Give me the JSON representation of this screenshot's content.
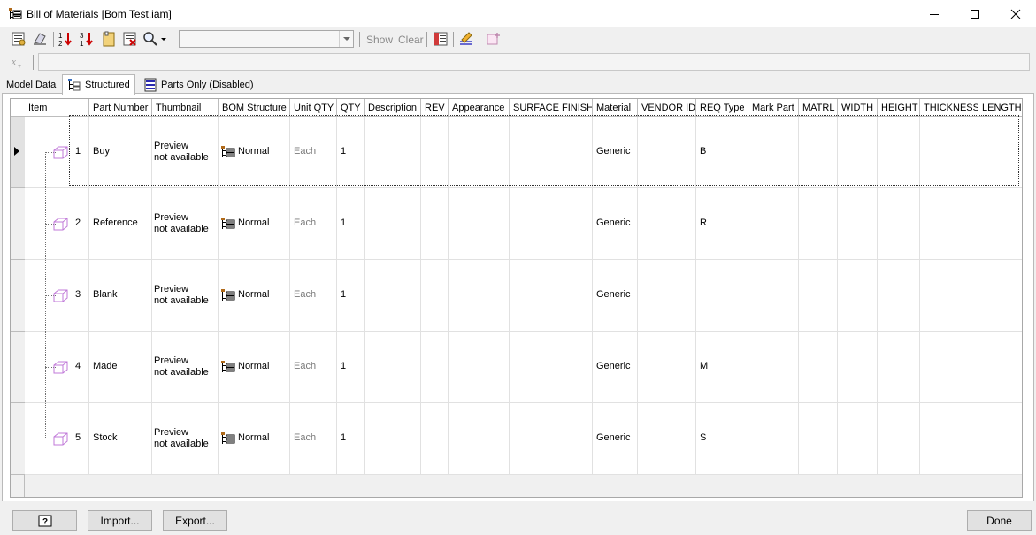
{
  "window": {
    "title": "Bill of Materials [Bom Test.iam]"
  },
  "toolbar": {
    "view_combo_value": "",
    "show_label": "Show",
    "clear_label": "Clear",
    "icons": [
      "bom-settings-icon",
      "clear-overrides-icon",
      "sort-ascending-icon",
      "sort-descending-icon",
      "renumber-icon",
      "export-icon",
      "find-icon",
      "column-chooser-icon",
      "member-tools-icon",
      "add-custom-part-icon"
    ]
  },
  "formula": {
    "value": ""
  },
  "tabs": [
    {
      "label": "Model Data"
    },
    {
      "label": "Structured"
    },
    {
      "label": "Parts Only (Disabled)"
    }
  ],
  "columns": [
    "Item",
    "Part Number",
    "Thumbnail",
    "BOM Structure",
    "Unit QTY",
    "QTY",
    "Description",
    "REV",
    "Appearance",
    "SURFACE FINISH",
    "Material",
    "VENDOR ID",
    "REQ Type",
    "Mark Part",
    "MATRL",
    "WIDTH",
    "HEIGHT",
    "THICKNESS",
    "LENGTH"
  ],
  "rows": [
    {
      "item": "1",
      "part_number": "Buy",
      "thumb_line1": "Preview",
      "thumb_line2": "not available",
      "bom_structure": "Normal",
      "unit_qty": "Each",
      "qty": "1",
      "material": "Generic",
      "req_type": "B"
    },
    {
      "item": "2",
      "part_number": "Reference",
      "thumb_line1": "Preview",
      "thumb_line2": "not available",
      "bom_structure": "Normal",
      "unit_qty": "Each",
      "qty": "1",
      "material": "Generic",
      "req_type": "R"
    },
    {
      "item": "3",
      "part_number": "Blank",
      "thumb_line1": "Preview",
      "thumb_line2": "not available",
      "bom_structure": "Normal",
      "unit_qty": "Each",
      "qty": "1",
      "material": "Generic",
      "req_type": ""
    },
    {
      "item": "4",
      "part_number": "Made",
      "thumb_line1": "Preview",
      "thumb_line2": "not available",
      "bom_structure": "Normal",
      "unit_qty": "Each",
      "qty": "1",
      "material": "Generic",
      "req_type": "M"
    },
    {
      "item": "5",
      "part_number": "Stock",
      "thumb_line1": "Preview",
      "thumb_line2": "not available",
      "bom_structure": "Normal",
      "unit_qty": "Each",
      "qty": "1",
      "material": "Generic",
      "req_type": "S"
    }
  ],
  "buttons": {
    "help_icon": "help-icon",
    "import": "Import...",
    "export": "Export...",
    "done": "Done"
  }
}
